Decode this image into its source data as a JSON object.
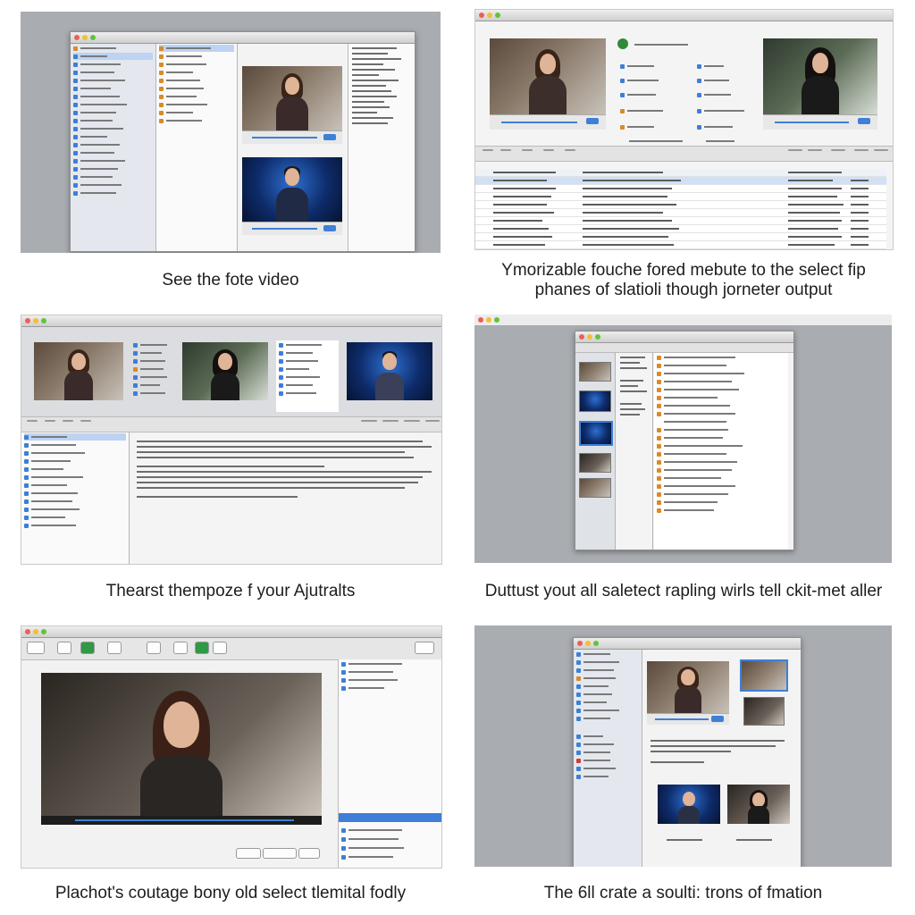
{
  "panels": [
    {
      "caption": "See the fote video"
    },
    {
      "caption": "Ymorizable fouche fored mebute to the select fip phanes of slatioli though jorneter output"
    },
    {
      "caption": "Thearst thempoze f your Ajutralts"
    },
    {
      "caption": "Duttust yout all saletect rapling wirls tell ckit-met aller"
    },
    {
      "caption": "Plachot's coutage bony old select tlemital fodly"
    },
    {
      "caption": "The 6ll crate a soulti: trons of fmation"
    }
  ],
  "colors": {
    "accent_blue": "#3f7fd8",
    "selection": "#bcd3f2",
    "panel_bg": "#a9acb1"
  },
  "icons": [
    "close-dot-icon",
    "minimize-dot-icon",
    "zoom-dot-icon",
    "play-icon",
    "folder-icon"
  ]
}
